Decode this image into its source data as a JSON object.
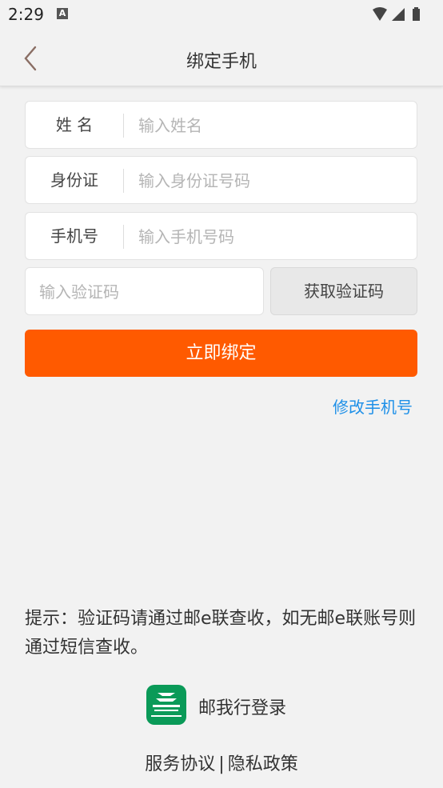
{
  "status_bar": {
    "time": "2:29",
    "notification_icon": "A"
  },
  "header": {
    "title": "绑定手机"
  },
  "form": {
    "name": {
      "label": "姓 名",
      "placeholder": "输入姓名",
      "value": ""
    },
    "id_card": {
      "label": "身份证",
      "placeholder": "输入身份证号码",
      "value": ""
    },
    "phone": {
      "label": "手机号",
      "placeholder": "输入手机号码",
      "value": ""
    },
    "code": {
      "placeholder": "输入验证码",
      "value": ""
    },
    "get_code_label": "获取验证码",
    "submit_label": "立即绑定",
    "change_phone_link": "修改手机号"
  },
  "tip": "提示：验证码请通过邮e联查收，如无邮e联账号则通过短信查收。",
  "post_login": {
    "label": "邮我行登录"
  },
  "footer": {
    "service_agreement": "服务协议",
    "separator": "|",
    "privacy_policy": "隐私政策"
  },
  "colors": {
    "accent": "#ff5a00",
    "link": "#1e90e8",
    "post_green": "#0a9a58"
  }
}
